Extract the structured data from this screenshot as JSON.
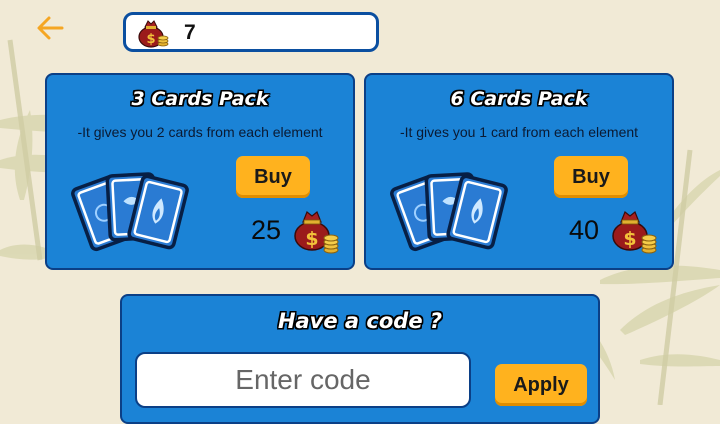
{
  "header": {
    "back_icon": "arrow-left-icon",
    "coin_icon": "money-bag-icon",
    "coins": "7"
  },
  "packs": [
    {
      "title": "3 Cards Pack",
      "description": "-It gives you 2 cards from each element",
      "buy_label": "Buy",
      "price": "25",
      "price_icon": "money-bag-icon"
    },
    {
      "title": "6 Cards Pack",
      "description": "-It gives you 1 card from each element",
      "buy_label": "Buy",
      "price": "40",
      "price_icon": "money-bag-icon"
    }
  ],
  "code": {
    "title": "Have a code ?",
    "placeholder": "Enter code",
    "value": "",
    "apply_label": "Apply"
  },
  "colors": {
    "background": "#f1ead6",
    "panel": "#1b83d6",
    "panel_border": "#0b3f86",
    "button": "#ffb21e",
    "back_arrow": "#f5a623"
  }
}
